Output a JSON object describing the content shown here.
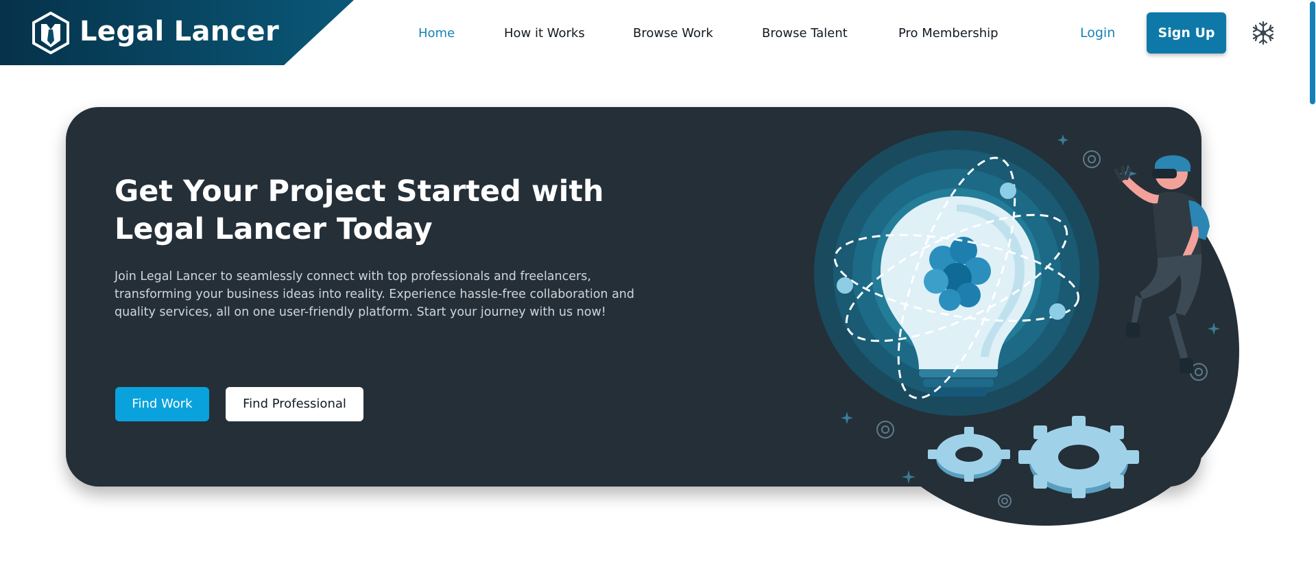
{
  "brand": {
    "name": "Legal Lancer",
    "color": "#0a4a66"
  },
  "nav": {
    "items": [
      {
        "label": "Home",
        "active": true
      },
      {
        "label": "How it Works",
        "active": false
      },
      {
        "label": "Browse Work",
        "active": false
      },
      {
        "label": "Browse Talent",
        "active": false
      },
      {
        "label": "Pro Membership",
        "active": false
      }
    ],
    "login_label": "Login",
    "signup_label": "Sign Up",
    "settings_icon": "snowflake-gear-icon"
  },
  "hero": {
    "title": "Get Your Project Started with Legal Lancer Today",
    "description": "Join Legal Lancer to seamlessly connect with top professionals and freelancers, transforming your business ideas into reality. Experience hassle-free collaboration and quality services, all on one user-friendly platform. Start your journey with us now!",
    "find_work_label": "Find Work",
    "find_professional_label": "Find Professional",
    "illustration": "lightbulb-atom-gears-person-illustration"
  },
  "colors": {
    "accent": "#1482b6",
    "hero_bg": "#252f38",
    "primary_button": "#0aa2dc",
    "signup_button": "#0e79a8"
  }
}
